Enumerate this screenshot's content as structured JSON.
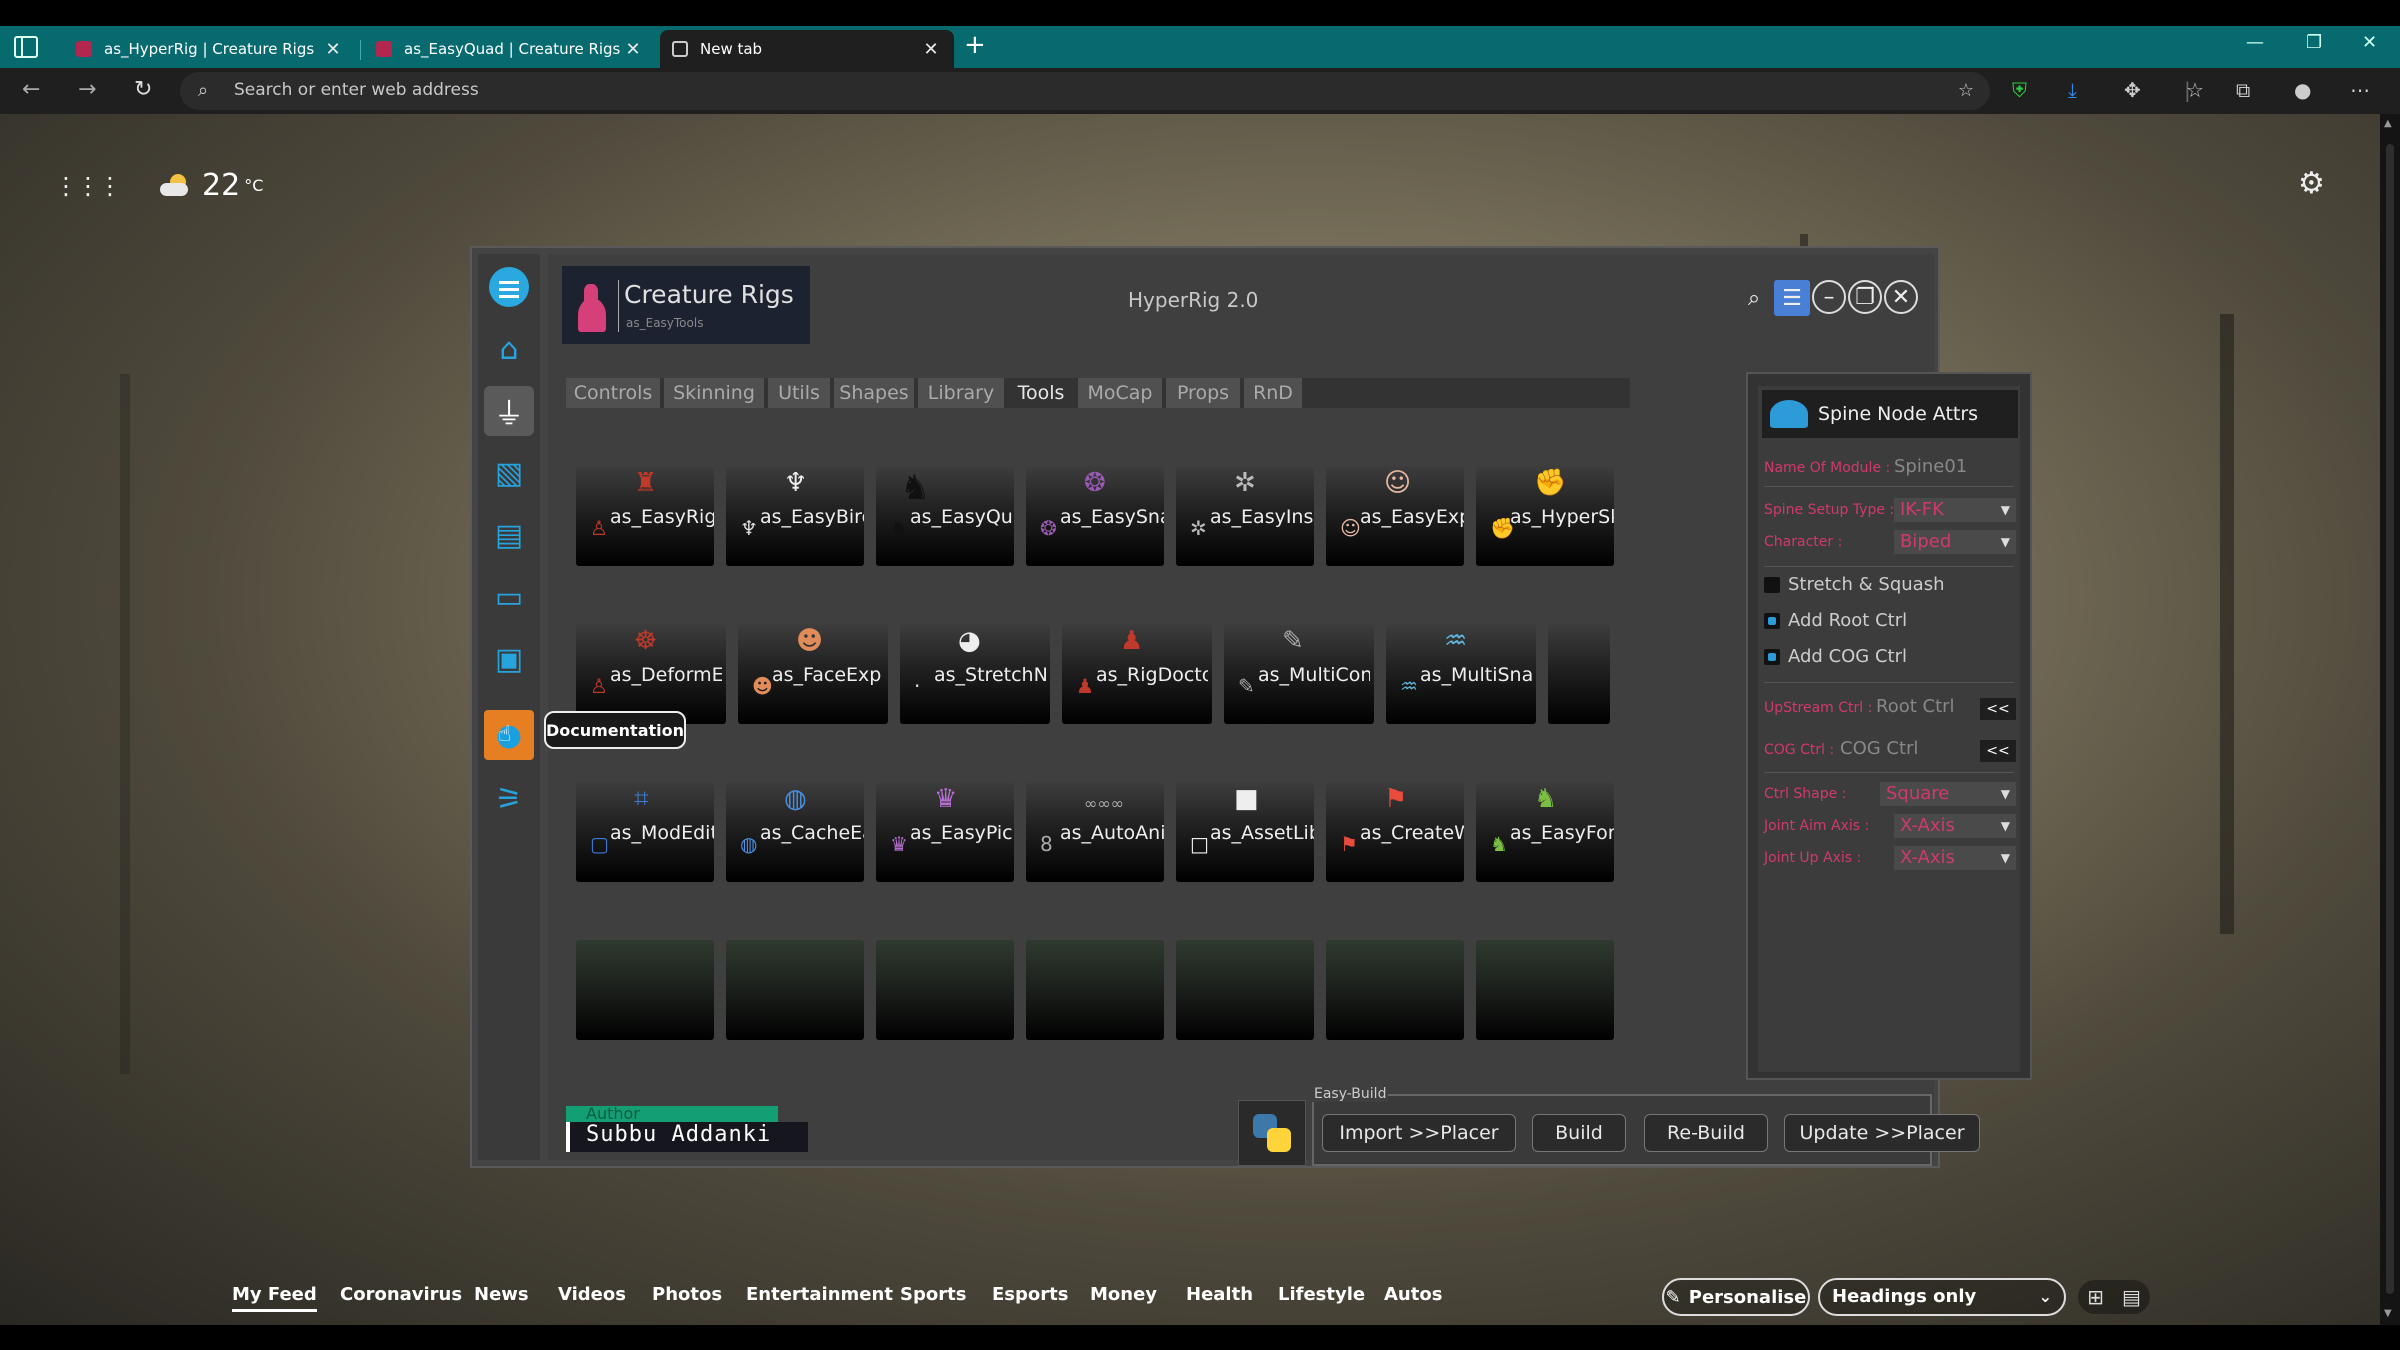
{
  "browser": {
    "tabs": [
      {
        "label": "as_HyperRig | Creature Rigs",
        "close": "✕"
      },
      {
        "label": "as_EasyQuad | Creature Rigs",
        "close": "✕"
      },
      {
        "label": "New tab",
        "close": "✕"
      }
    ],
    "new_tab": "+",
    "address_placeholder": "Search or enter web address"
  },
  "newtab_page": {
    "temperature": "22",
    "temp_unit": "°C",
    "feed": [
      "My Feed",
      "Coronavirus",
      "News",
      "Videos",
      "Photos",
      "Entertainment",
      "Sports",
      "Esports",
      "Money",
      "Health",
      "Lifestyle",
      "Autos"
    ],
    "personalise_label": "Personalise",
    "headings_label": "Headings only"
  },
  "rig_app": {
    "brand_title": "Creature Rigs",
    "brand_subtitle": "as_EasyTools",
    "window_title": "HyperRig 2.0",
    "tooltip": "Documentation",
    "tabs": [
      "Controls",
      "Skinning",
      "Utils",
      "Shapes",
      "Library",
      "Tools",
      "MoCap",
      "Props",
      "RnD"
    ],
    "active_tab": "Tools",
    "tools_row1": [
      "as_EasyRig",
      "as_EasyBird",
      "as_EasyQuad",
      "as_EasySnake",
      "as_EasyInsect",
      "as_EasyExp",
      "as_HyperSkin"
    ],
    "tools_row2": [
      "as_DeformEasy",
      "as_FaceExp",
      "as_StretchNSquash",
      "as_RigDoctor",
      "as_MultiConstraint",
      "as_MultiSnake"
    ],
    "tools_row3": [
      "as_ModEdit",
      "as_CacheEasy",
      "as_EasyPick",
      "as_AutoAni",
      "as_AssetLib",
      "as_CreateWire",
      "as_EasyForm"
    ],
    "author_label": "Author",
    "author_name": "Subbu Addanki",
    "easy_build_label": "Easy-Build",
    "easy_build_buttons": [
      "Import >>Placer",
      "Build",
      "Re-Build",
      "Update >>Placer"
    ],
    "spine": {
      "header": "Spine Node Attrs",
      "name_of_module_label": "Name Of Module :",
      "name_of_module_value": "Spine01",
      "setup_type_label": "Spine Setup Type :",
      "setup_type_value": "IK-FK",
      "character_label": "Character :",
      "character_value": "Biped",
      "stretch_label": "Stretch & Squash",
      "root_label": "Add Root Ctrl",
      "cog_label": "Add COG Ctrl",
      "upstream_label": "UpStream Ctrl :",
      "upstream_value": "Root Ctrl",
      "cog_ctrl_label": "COG Ctrl :",
      "cog_ctrl_value": "COG Ctrl",
      "pick_btn": "<<",
      "ctrl_shape_label": "Ctrl Shape :",
      "ctrl_shape_value": "Square",
      "aim_axis_label": "Joint Aim Axis :",
      "aim_axis_value": "X-Axis",
      "up_axis_label": "Joint Up Axis :",
      "up_axis_value": "X-Axis"
    }
  },
  "colors": {
    "tabbar": "#066a6f",
    "accent_pink": "#d03a6b",
    "accent_blue": "#2d9bd8",
    "author_green": "#149e73"
  }
}
